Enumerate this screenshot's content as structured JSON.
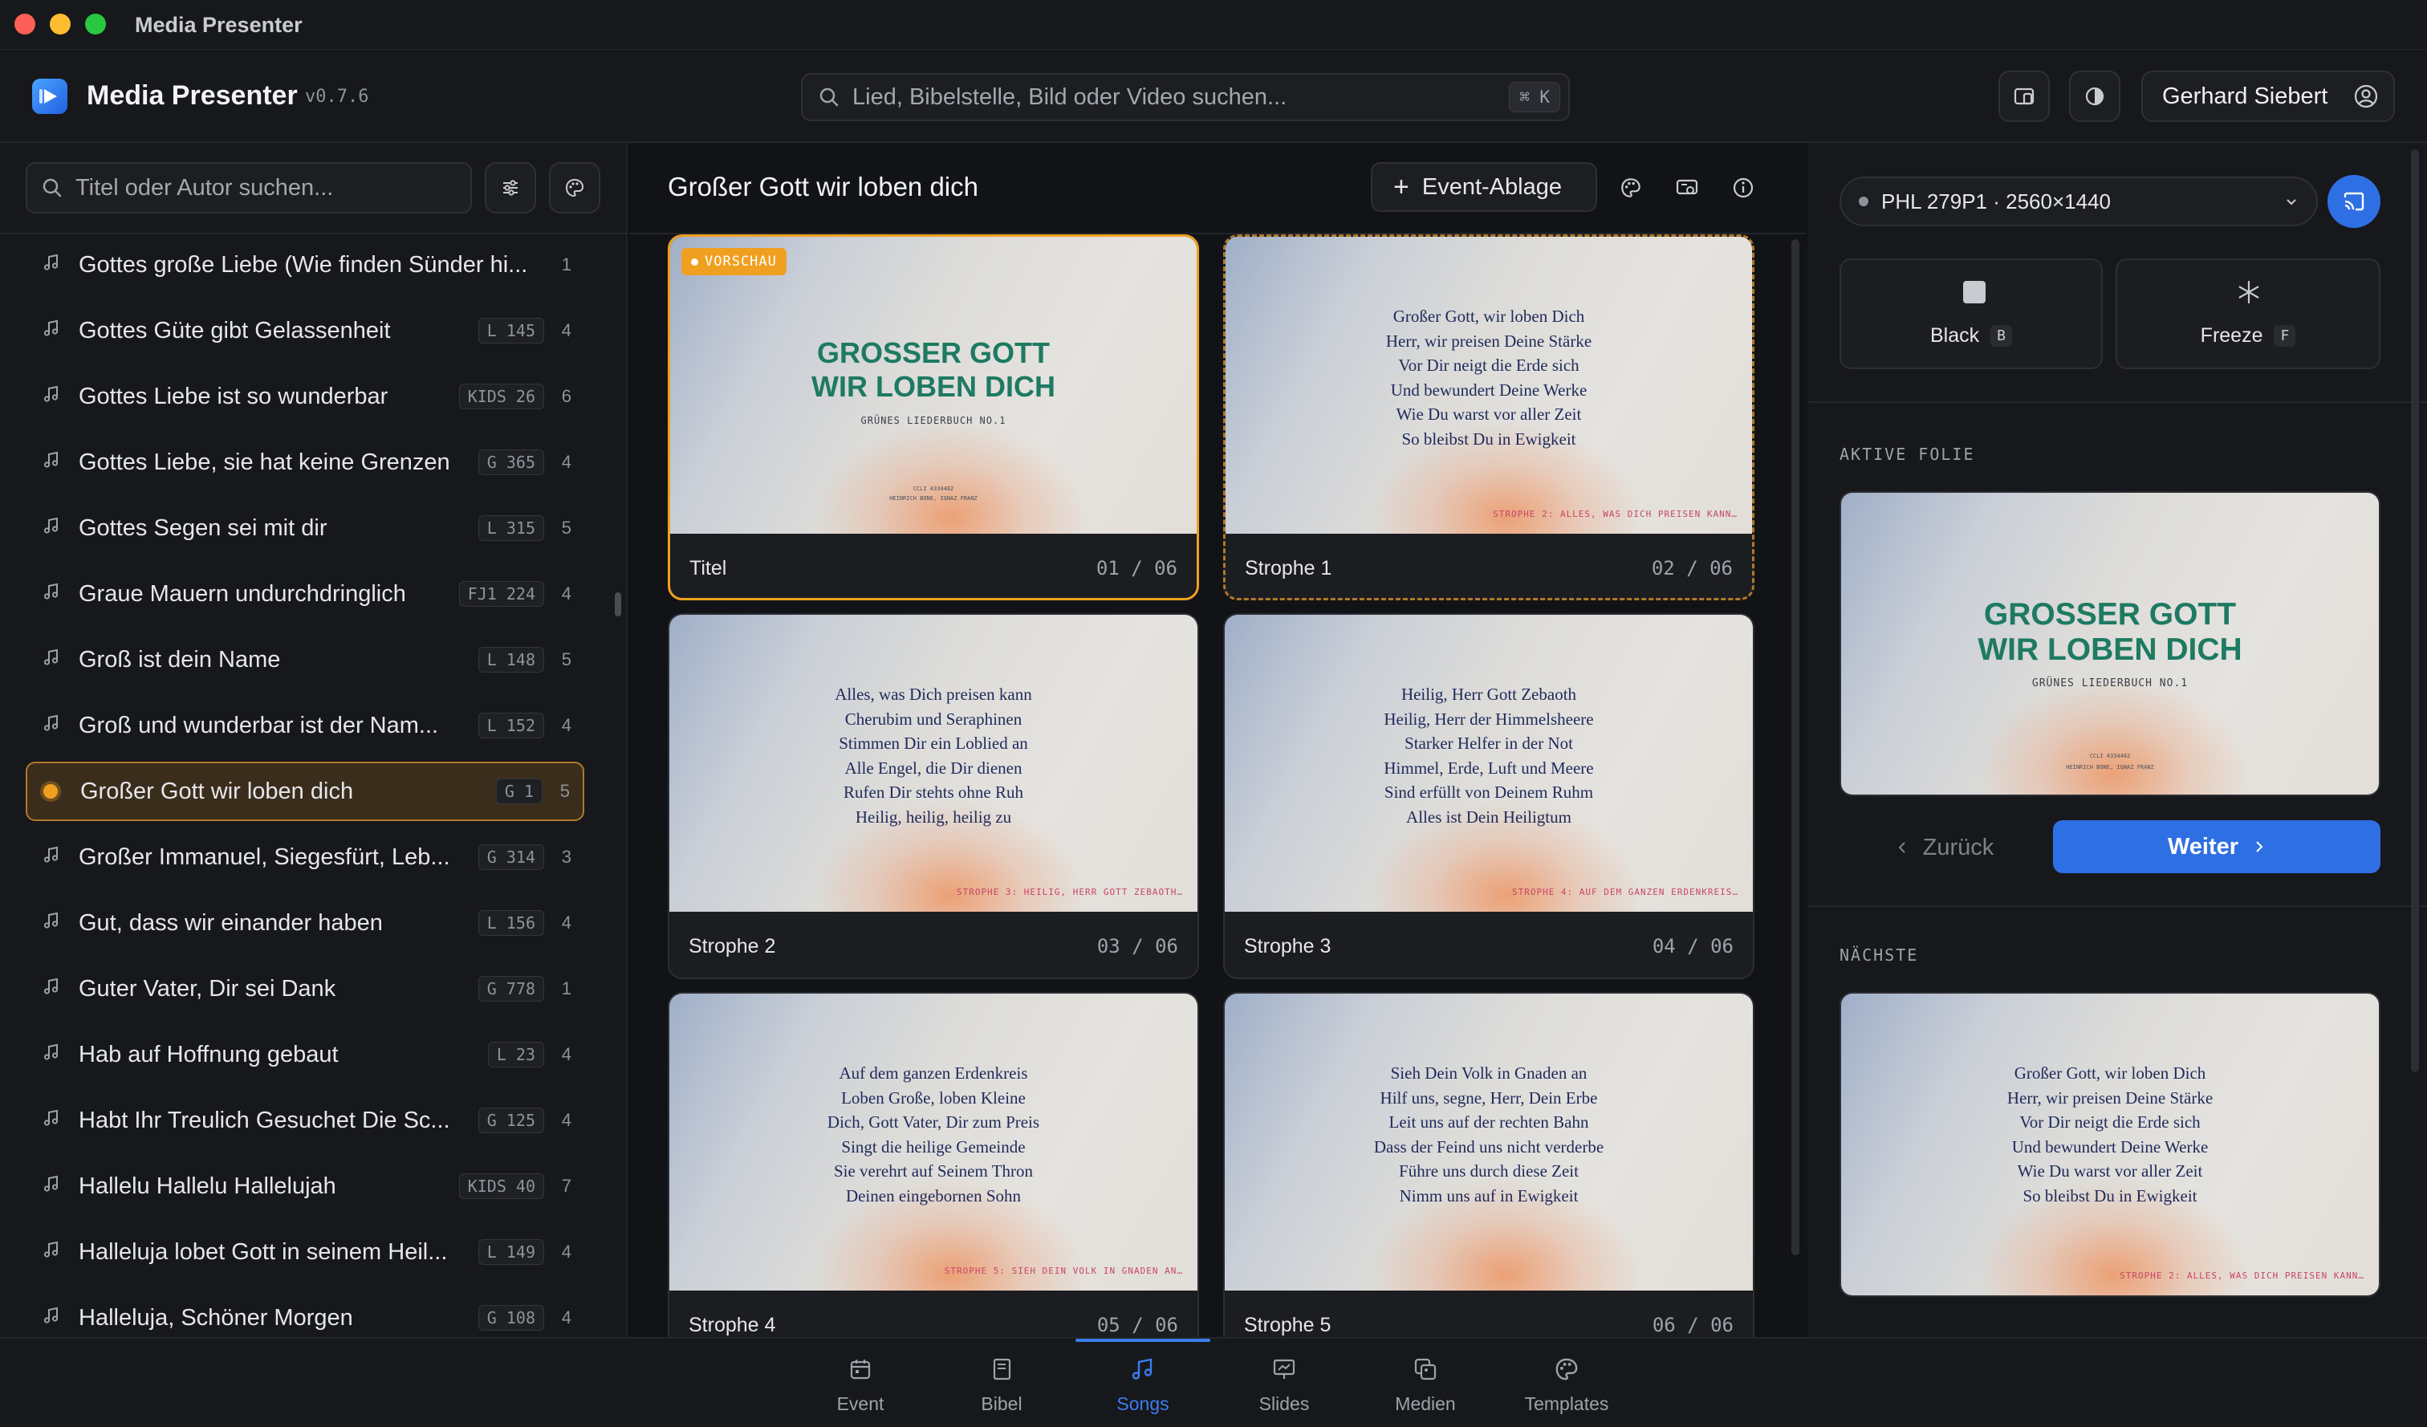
{
  "window": {
    "title": "Media Presenter"
  },
  "header": {
    "app_name": "Media Presenter",
    "version": "v0.7.6",
    "search_placeholder": "Lied, Bibelstelle, Bild oder Video suchen...",
    "search_shortcut": "⌘ K",
    "user_name": "Gerhard Siebert"
  },
  "sidebar": {
    "search_placeholder": "Titel oder Autor suchen...",
    "songs": [
      {
        "title": "Gottes große Liebe (Wie finden Sünder hi...",
        "code": "",
        "count": "1"
      },
      {
        "title": "Gottes Güte gibt Gelassenheit",
        "code": "L 145",
        "count": "4"
      },
      {
        "title": "Gottes Liebe ist so wunderbar",
        "code": "KIDS 26",
        "count": "6"
      },
      {
        "title": "Gottes Liebe, sie hat keine Grenzen",
        "code": "G 365",
        "count": "4"
      },
      {
        "title": "Gottes Segen sei mit dir",
        "code": "L 315",
        "count": "5"
      },
      {
        "title": "Graue Mauern undurchdringlich",
        "code": "FJ1 224",
        "count": "4"
      },
      {
        "title": "Groß ist dein Name",
        "code": "L 148",
        "count": "5"
      },
      {
        "title": "Groß und wunderbar ist der Nam...",
        "code": "L 152",
        "count": "4"
      },
      {
        "title": "Großer Gott wir loben dich",
        "code": "G 1",
        "count": "5"
      },
      {
        "title": "Großer Immanuel, Siegesfürt, Leb...",
        "code": "G 314",
        "count": "3"
      },
      {
        "title": "Gut, dass wir einander haben",
        "code": "L 156",
        "count": "4"
      },
      {
        "title": "Guter Vater, Dir sei Dank",
        "code": "G 778",
        "count": "1"
      },
      {
        "title": "Hab auf Hoffnung gebaut",
        "code": "L 23",
        "count": "4"
      },
      {
        "title": "Habt Ihr Treulich Gesuchet Die Sc...",
        "code": "G 125",
        "count": "4"
      },
      {
        "title": "Hallelu Hallelu Hallelujah",
        "code": "KIDS 40",
        "count": "7"
      },
      {
        "title": "Halleluja lobet Gott in seinem Heil...",
        "code": "L 149",
        "count": "4"
      },
      {
        "title": "Halleluja, Schöner Morgen",
        "code": "G 108",
        "count": "4"
      }
    ]
  },
  "main": {
    "song_title": "Großer Gott wir loben dich",
    "event_button": "Event-Ablage",
    "preview_badge": "VORSCHAU",
    "title_slide": {
      "line1": "GROSSER GOTT",
      "line2": "WIR LOBEN DICH",
      "subtitle": "GRÜNES LIEDERBUCH NO.1",
      "ccli": "CCLI 4334482",
      "authors": "HEINRICH BONE, IGNAZ FRANZ"
    },
    "slides": [
      {
        "label": "Titel",
        "num": "01 / 06"
      },
      {
        "label": "Strophe 1",
        "num": "02 / 06",
        "next": "STROPHE 2: ALLES, WAS DICH PREISEN KANN…",
        "lines": [
          "Großer Gott, wir loben Dich",
          "Herr, wir preisen Deine Stärke",
          "Vor Dir neigt die Erde sich",
          "Und bewundert Deine Werke",
          "Wie Du warst vor aller Zeit",
          "So bleibst Du in Ewigkeit"
        ]
      },
      {
        "label": "Strophe 2",
        "num": "03 / 06",
        "next": "STROPHE 3: HEILIG, HERR GOTT ZEBAOTH…",
        "lines": [
          "Alles, was Dich preisen kann",
          "Cherubim und Seraphinen",
          "Stimmen Dir ein Loblied an",
          "Alle Engel, die Dir dienen",
          "Rufen Dir stehts ohne Ruh",
          "Heilig, heilig, heilig zu"
        ]
      },
      {
        "label": "Strophe 3",
        "num": "04 / 06",
        "next": "STROPHE 4: AUF DEM GANZEN ERDENKREIS…",
        "lines": [
          "Heilig, Herr Gott Zebaoth",
          "Heilig, Herr der Himmelsheere",
          "Starker Helfer in der Not",
          "Himmel, Erde, Luft und Meere",
          "Sind erfüllt von Deinem Ruhm",
          "Alles ist Dein Heiligtum"
        ]
      },
      {
        "label": "Strophe 4",
        "num": "05 / 06",
        "next": "STROPHE 5: SIEH DEIN VOLK IN GNADEN AN…",
        "lines": [
          "Auf dem ganzen Erdenkreis",
          "Loben Große, loben Kleine",
          "Dich, Gott Vater, Dir zum Preis",
          "Singt die heilige Gemeinde",
          "Sie verehrt auf Seinem Thron",
          "Deinen eingebornen Sohn"
        ]
      },
      {
        "label": "Strophe 5",
        "num": "06 / 06",
        "next": "",
        "lines": [
          "Sieh Dein Volk in Gnaden an",
          "Hilf uns, segne, Herr, Dein Erbe",
          "Leit uns auf der rechten Bahn",
          "Dass der Feind uns nicht verderbe",
          "Führe uns durch diese Zeit",
          "Nimm uns auf in Ewigkeit"
        ]
      }
    ]
  },
  "control": {
    "display": "PHL 279P1 · 2560×1440",
    "black_label": "Black",
    "black_key": "B",
    "freeze_label": "Freeze",
    "freeze_key": "F",
    "active_heading": "AKTIVE FOLIE",
    "back_label": "Zurück",
    "next_label": "Weiter",
    "next_heading": "NÄCHSTE"
  },
  "bottom_nav": [
    {
      "label": "Event",
      "icon": "calendar-icon"
    },
    {
      "label": "Bibel",
      "icon": "book-icon"
    },
    {
      "label": "Songs",
      "icon": "music-icon",
      "active": true
    },
    {
      "label": "Slides",
      "icon": "presentation-icon"
    },
    {
      "label": "Medien",
      "icon": "media-icon"
    },
    {
      "label": "Templates",
      "icon": "palette-icon"
    }
  ],
  "colors": {
    "accent": "#2f6fe4",
    "preview": "#f0a020",
    "title_green": "#1e7a62",
    "lyrics": "#1f2a5a"
  }
}
